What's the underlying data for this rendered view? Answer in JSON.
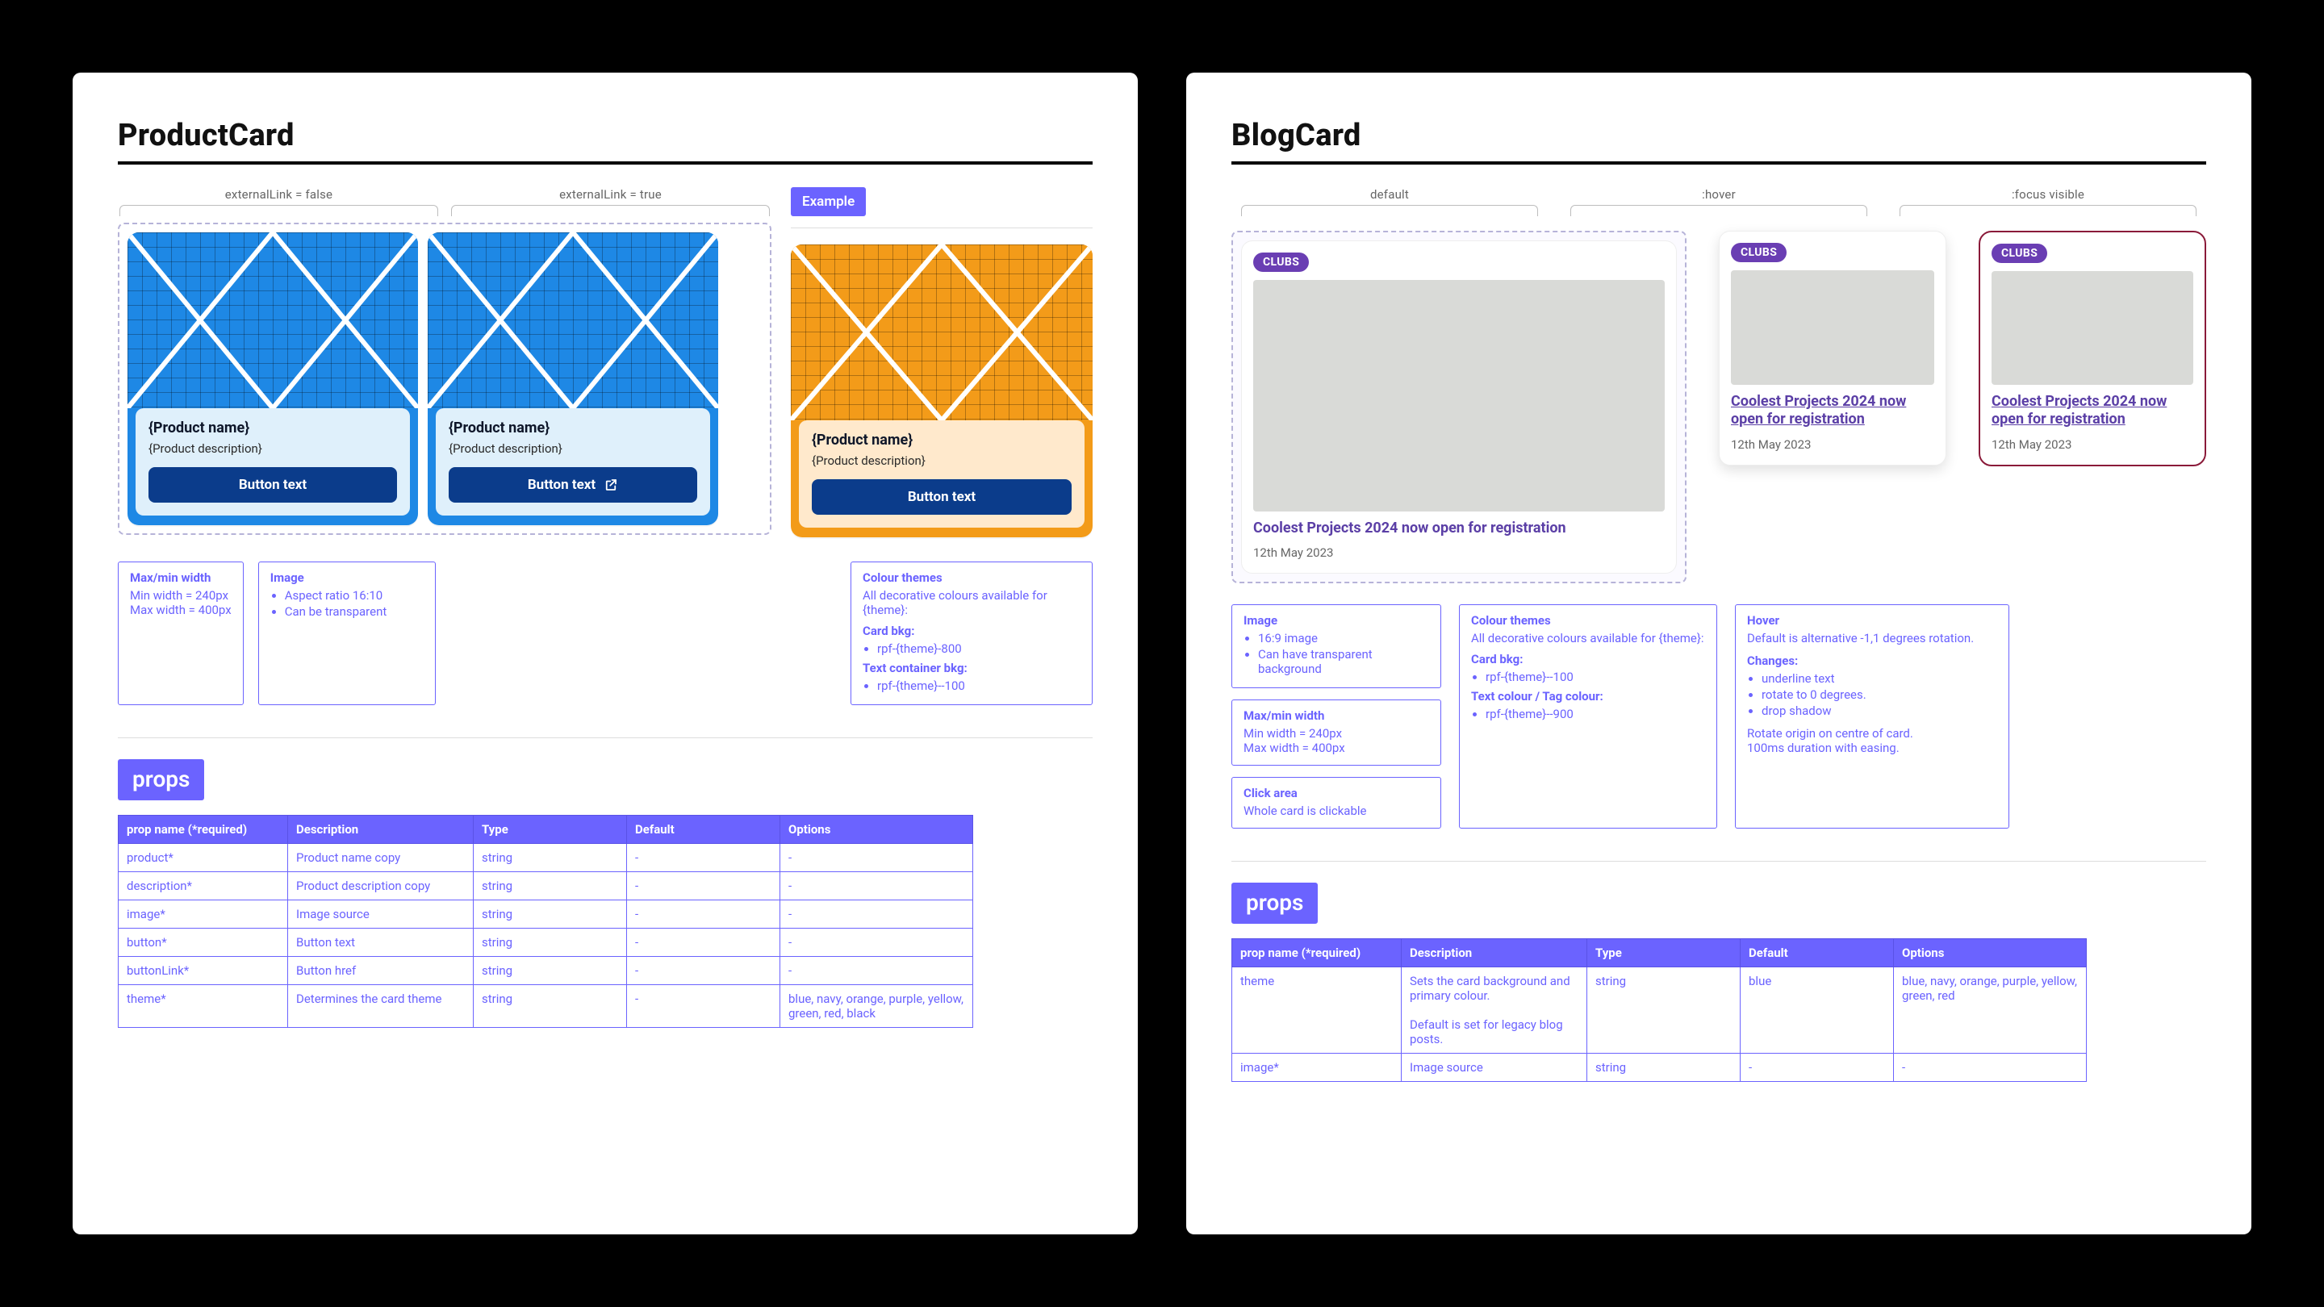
{
  "left": {
    "title": "ProductCard",
    "variant_labels": {
      "false": "externalLink = false",
      "true": "externalLink = true"
    },
    "example_label": "Example",
    "card": {
      "name": "{Product name}",
      "desc": "{Product description}",
      "button": "Button text"
    },
    "notes": {
      "size": {
        "title": "Max/min width",
        "min": "Min width = 240px",
        "max": "Max width = 400px"
      },
      "image": {
        "title": "Image",
        "l1": "Aspect ratio 16:10",
        "l2": "Can be transparent"
      },
      "themes": {
        "title": "Colour themes",
        "intro": "All decorative colours available for {theme}:",
        "cardbkg_title": "Card bkg:",
        "cardbkg": "rpf-{theme}-800",
        "textbkg_title": "Text container bkg:",
        "textbkg": "rpf-{theme}--100"
      }
    },
    "props_label": "props",
    "props_headers": {
      "name": "prop name  (*required)",
      "desc": "Description",
      "type": "Type",
      "def": "Default",
      "opt": "Options"
    },
    "props": [
      {
        "name": "product*",
        "desc": "Product name copy",
        "type": "string",
        "def": "-",
        "opt": "-"
      },
      {
        "name": "description*",
        "desc": "Product description copy",
        "type": "string",
        "def": "-",
        "opt": "-"
      },
      {
        "name": "image*",
        "desc": "Image source",
        "type": "string",
        "def": "-",
        "opt": "-"
      },
      {
        "name": "button*",
        "desc": "Button text",
        "type": "string",
        "def": "-",
        "opt": "-"
      },
      {
        "name": "buttonLink*",
        "desc": "Button href",
        "type": "string",
        "def": "-",
        "opt": "-"
      },
      {
        "name": "theme*",
        "desc": "Determines the card theme",
        "type": "string",
        "def": "-",
        "opt": "blue, navy, orange, purple, yellow, green, red, black"
      }
    ]
  },
  "right": {
    "title": "BlogCard",
    "state_labels": {
      "default": "default",
      "hover": ":hover",
      "focus": ":focus visible"
    },
    "tag": "CLUBS",
    "card": {
      "title": "Coolest Projects 2024 now open for registration",
      "date": "12th May 2023"
    },
    "notes": {
      "image": {
        "title": "Image",
        "l1": "16:9 image",
        "l2": "Can have transparent background"
      },
      "size": {
        "title": "Max/min width",
        "min": "Min width = 240px",
        "max": "Max width = 400px"
      },
      "click": {
        "title": "Click area",
        "l1": "Whole card is clickable"
      },
      "themes": {
        "title": "Colour themes",
        "intro": "All decorative colours available for {theme}:",
        "cardbkg_title": "Card bkg:",
        "cardbkg": "rpf-{theme}--100",
        "tag_title": "Text colour / Tag colour:",
        "tag": "rpf-{theme}--900"
      },
      "hover": {
        "title": "Hover",
        "intro": "Default is alternative -1,1 degrees rotation.",
        "changes_title": "Changes:",
        "c1": "underline text",
        "c2": "rotate to 0 degrees.",
        "c3": "drop shadow",
        "out1": "Rotate origin on centre of card.",
        "out2": "100ms duration with easing."
      }
    },
    "props_label": "props",
    "props_headers": {
      "name": "prop name  (*required)",
      "desc": "Description",
      "type": "Type",
      "def": "Default",
      "opt": "Options"
    },
    "props": [
      {
        "name": "theme",
        "desc": "Sets the card background and primary colour.\n\nDefault is set for legacy blog posts.",
        "type": "string",
        "def": "blue",
        "opt": "blue, navy, orange, purple, yellow, green, red"
      },
      {
        "name": "image*",
        "desc": "Image source",
        "type": "string",
        "def": "-",
        "opt": "-"
      }
    ]
  }
}
